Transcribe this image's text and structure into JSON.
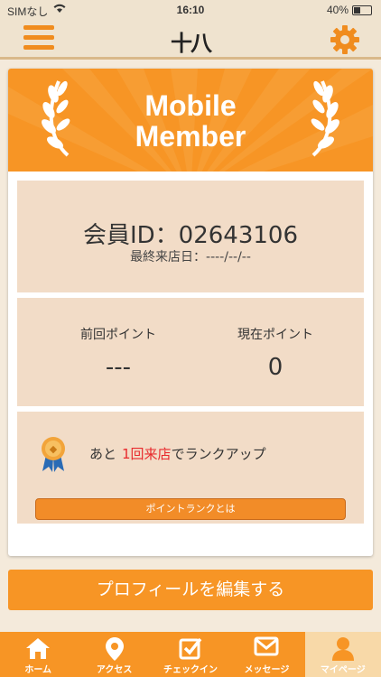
{
  "status": {
    "carrier": "SIMなし",
    "time": "16:10",
    "battery": "40%"
  },
  "header": {
    "logo_text": "十八",
    "menu_icon": "hamburger-icon",
    "settings_icon": "gear-icon"
  },
  "banner": {
    "title_line1": "Mobile",
    "title_line2": "Member"
  },
  "member": {
    "id_label": "会員ID：02643106",
    "last_visit": "最終来店日：----/--/--"
  },
  "points": {
    "prev_label": "前回ポイント",
    "prev_value": "---",
    "current_label": "現在ポイント",
    "current_value": "0"
  },
  "rank": {
    "prefix": "あと",
    "highlight": "1回来店",
    "suffix": "でランクアップ",
    "button_label": "ポイントランクとは"
  },
  "edit_profile_label": "プロフィールを編集する",
  "tabs": [
    {
      "label": "ホーム",
      "icon": "home-icon"
    },
    {
      "label": "アクセス",
      "icon": "location-pin-icon"
    },
    {
      "label": "チェックイン",
      "icon": "checkin-icon"
    },
    {
      "label": "メッセージ",
      "icon": "mail-icon"
    },
    {
      "label": "マイページ",
      "icon": "person-icon"
    }
  ],
  "colors": {
    "accent": "#f79525",
    "panel": "#f2dcc7",
    "highlight": "#e8292c",
    "background": "#f4eadb"
  }
}
